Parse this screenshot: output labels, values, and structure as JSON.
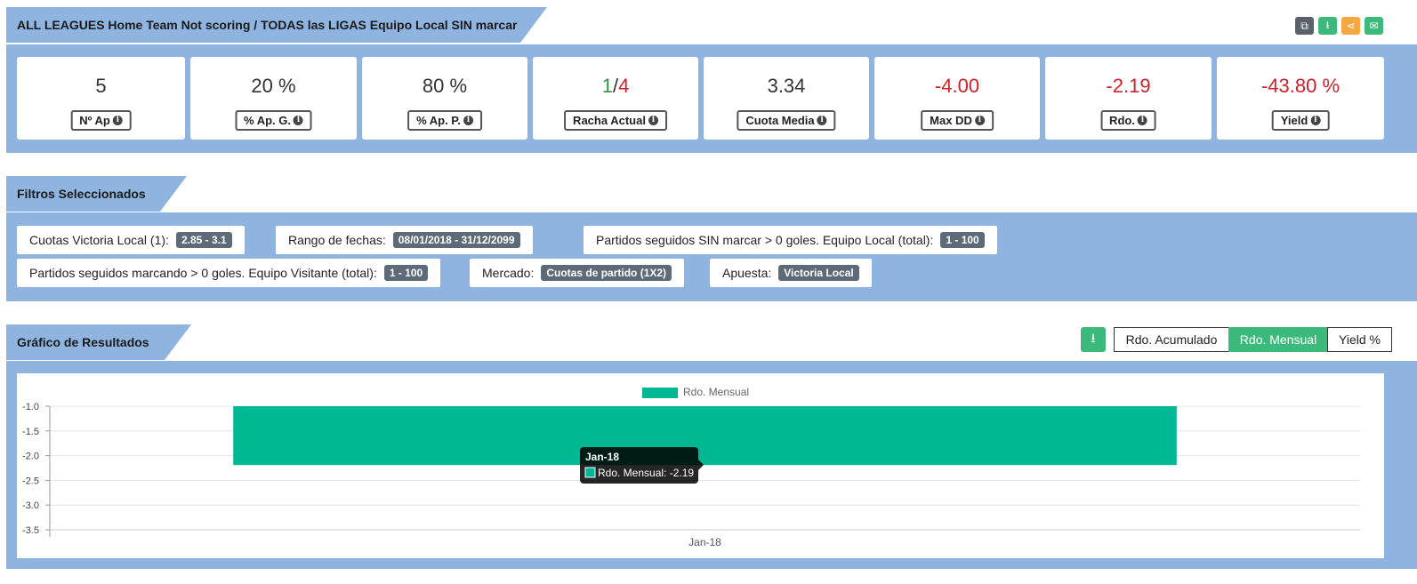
{
  "header": {
    "title": "ALL LEAGUES Home Team Not scoring / TODAS las LIGAS Equipo Local SIN marcar"
  },
  "toolbar": {
    "icons": [
      "copy-icon",
      "download-icon",
      "share-icon",
      "email-icon"
    ],
    "colors": [
      "#5a6168",
      "#3cba7c",
      "#f5a742",
      "#3cba7c"
    ]
  },
  "stats": [
    {
      "value": "5",
      "label": "Nº Ap",
      "neg": false
    },
    {
      "value": "20 %",
      "label": "% Ap. G.",
      "neg": false
    },
    {
      "value": "80 %",
      "label": "% Ap. P.",
      "neg": false
    },
    {
      "value_green": "1",
      "value_sep": "/",
      "value_red": "4",
      "label": "Racha Actual",
      "racha": true
    },
    {
      "value": "3.34",
      "label": "Cuota Media",
      "neg": false
    },
    {
      "value": "-4.00",
      "label": "Max DD",
      "neg": true
    },
    {
      "value": "-2.19",
      "label": "Rdo.",
      "neg": true
    },
    {
      "value": "-43.80 %",
      "label": "Yield",
      "neg": true
    }
  ],
  "filters": {
    "title": "Filtros Seleccionados",
    "items": [
      {
        "label": "Cuotas Victoria Local (1):",
        "badge": "2.85 - 3.1"
      },
      {
        "label": "Rango de fechas:",
        "badge": "08/01/2018 - 31/12/2099"
      },
      {
        "label": "Partidos seguidos SIN marcar > 0 goles. Equipo Local (total):",
        "badge": "1 - 100"
      },
      {
        "label": "Partidos seguidos marcando > 0 goles. Equipo Visitante (total):",
        "badge": "1 - 100"
      },
      {
        "label": "Mercado:",
        "badge": "Cuotas de partido (1X2)"
      },
      {
        "label": "Apuesta:",
        "badge": "Victoria Local"
      }
    ]
  },
  "results": {
    "title": "Gráfico de Resultados",
    "tabs": [
      "Rdo. Acumulado",
      "Rdo. Mensual",
      "Yield %"
    ],
    "active_tab": "Rdo. Mensual"
  },
  "chart_data": {
    "type": "bar",
    "categories": [
      "Jan-18"
    ],
    "series": [
      {
        "name": "Rdo. Mensual",
        "values": [
          -2.19
        ]
      }
    ],
    "ylim": [
      -3.5,
      -1.0
    ],
    "yticks": [
      "-1.0",
      "-1.5",
      "-2.0",
      "-2.5",
      "-3.0",
      "-3.5"
    ],
    "legend": "top",
    "color": "#00b894",
    "grid": true,
    "tooltip": {
      "title": "Jan-18",
      "text": "Rdo. Mensual: -2.19"
    }
  }
}
